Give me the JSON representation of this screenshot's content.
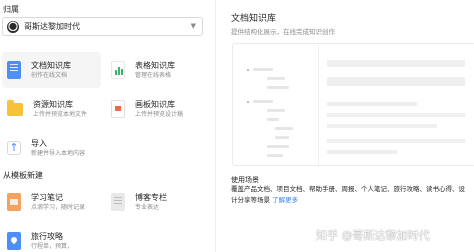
{
  "owner": {
    "label": "归属",
    "name": "哥斯达黎加时代"
  },
  "create_cards": [
    {
      "title": "文档知识库",
      "desc": "创作在线文档",
      "icon": "document-icon"
    },
    {
      "title": "表格知识库",
      "desc": "管理在线表格",
      "icon": "spreadsheet-icon"
    },
    {
      "title": "资源知识库",
      "desc": "上传并预览本地文件",
      "icon": "folder-icon"
    },
    {
      "title": "画板知识库",
      "desc": "上传并预览设计稿",
      "icon": "board-icon"
    },
    {
      "title": "导入",
      "desc": "新建并导入本地内容",
      "icon": "import-arrow-icon",
      "glyph": "↑"
    }
  ],
  "template_section": {
    "label": "从模板新建",
    "cards": [
      {
        "title": "学习笔记",
        "desc": "点滴学习，随时记录",
        "icon": "note-icon"
      },
      {
        "title": "博客专栏",
        "desc": "专业表达",
        "icon": "blog-icon"
      },
      {
        "title": "旅行攻略",
        "desc": "行程单，预算，",
        "icon": "travel-map-icon"
      }
    ]
  },
  "preview": {
    "title": "文档知识库",
    "subtitle": "提供结构化展示，在线完成知识创作",
    "usage_title": "使用场景",
    "usage_text": "覆盖产品文档、项目文档、帮助手册、周报、个人笔记、旅行攻略、读书心得、设计分享等场景",
    "usage_link": "了解更多"
  },
  "watermark": "知乎 @哥斯达黎加时代",
  "colors": {
    "accent": "#2f7ff4",
    "selected_bg": "#f5f5f5"
  }
}
